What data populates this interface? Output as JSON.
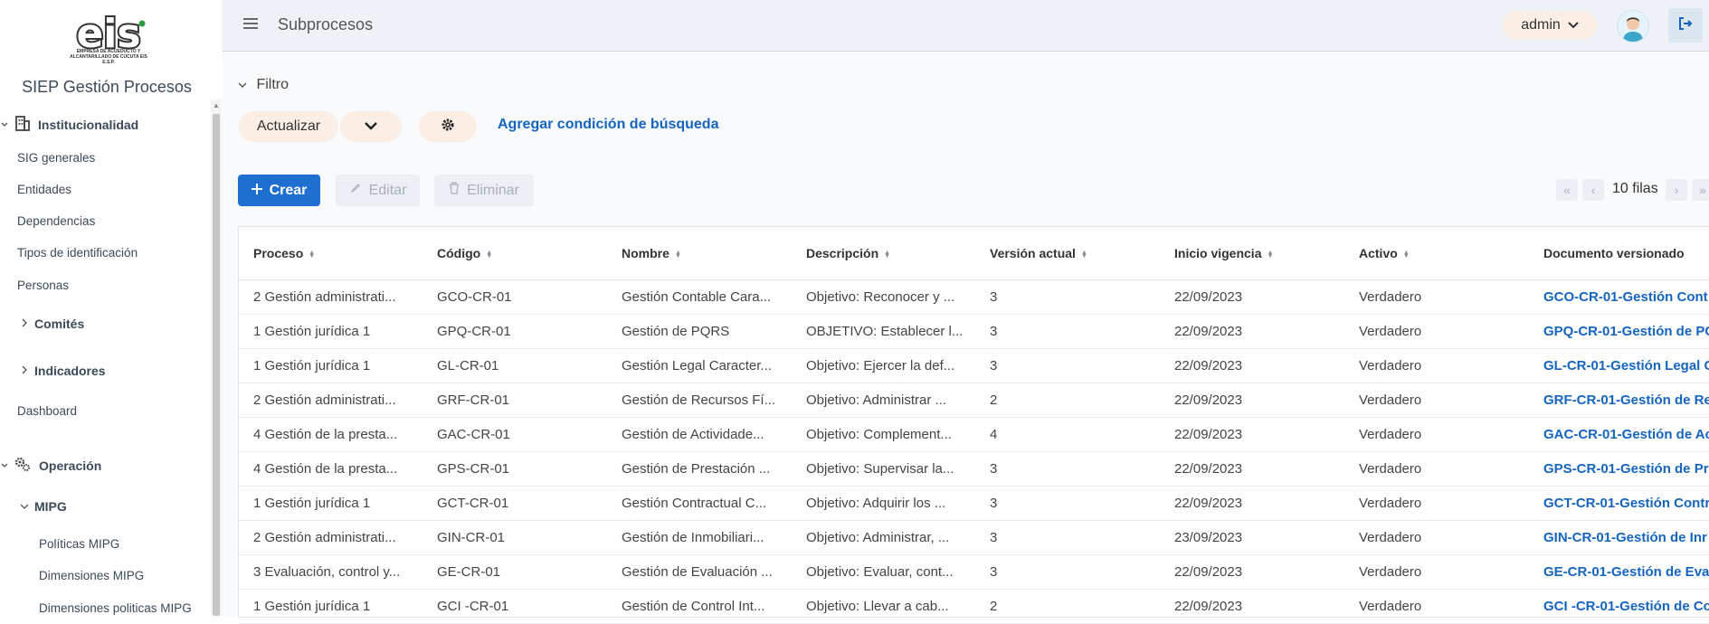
{
  "app": {
    "title": "SIEP Gestión Procesos",
    "logo_text": "eis",
    "logo_caption": "EMPRESA DE ACUEDUCTO Y ALCANTARILLADO DE CÚCUTA EIS E.S.P."
  },
  "sidebar": {
    "group_institucionalidad": "Institucionalidad",
    "items_institucionalidad": [
      "SIG generales",
      "Entidades",
      "Dependencias",
      "Tipos de identificación",
      "Personas"
    ],
    "comites": "Comités",
    "indicadores": "Indicadores",
    "dashboard": "Dashboard",
    "group_operacion": "Operación",
    "mipg": "MIPG",
    "mipg_items": [
      "Políticas MIPG",
      "Dimensiones MIPG",
      "Dimensiones politicas MIPG"
    ]
  },
  "header": {
    "title": "Subprocesos",
    "user": "admin"
  },
  "toolbar": {
    "filter": "Filtro",
    "refresh": "Actualizar",
    "add_condition": "Agregar condición de búsqueda",
    "create": "Crear",
    "edit": "Editar",
    "delete": "Eliminar",
    "rows": "10 filas"
  },
  "colors": {
    "primary": "#1f6fd0",
    "link": "#1565c0",
    "soft_button": "#fbeee4",
    "header_bg": "#eef2f7"
  },
  "table": {
    "columns": [
      "Proceso",
      "Código",
      "Nombre",
      "Descripción",
      "Versión actual",
      "Inicio vigencia",
      "Activo",
      "Documento versionado"
    ],
    "rows": [
      [
        "2 Gestión administrati...",
        "GCO-CR-01",
        "Gestión Contable Cara...",
        "Objetivo: Reconocer y ...",
        "3",
        "22/09/2023",
        "Verdadero",
        "GCO-CR-01-Gestión Cont"
      ],
      [
        "1 Gestión jurídica 1",
        "GPQ-CR-01",
        "Gestión de PQRS",
        "OBJETIVO: Establecer l...",
        "3",
        "22/09/2023",
        "Verdadero",
        "GPQ-CR-01-Gestión de PC"
      ],
      [
        "1 Gestión jurídica 1",
        "GL-CR-01",
        "Gestión Legal Caracter...",
        "Objetivo: Ejercer la def...",
        "3",
        "22/09/2023",
        "Verdadero",
        "GL-CR-01-Gestión Legal C"
      ],
      [
        "2 Gestión administrati...",
        "GRF-CR-01",
        "Gestión de Recursos Fí...",
        "Objetivo: Administrar ...",
        "2",
        "22/09/2023",
        "Verdadero",
        "GRF-CR-01-Gestión de Re"
      ],
      [
        "4 Gestión de la presta...",
        "GAC-CR-01",
        "Gestión de Actividade...",
        "Objetivo: Complement...",
        "4",
        "22/09/2023",
        "Verdadero",
        "GAC-CR-01-Gestión de Ac"
      ],
      [
        "4 Gestión de la presta...",
        "GPS-CR-01",
        "Gestión de Prestación ...",
        "Objetivo: Supervisar la...",
        "3",
        "22/09/2023",
        "Verdadero",
        "GPS-CR-01-Gestión de Pr"
      ],
      [
        "1 Gestión jurídica 1",
        "GCT-CR-01",
        "Gestión Contractual C...",
        "Objetivo: Adquirir los ...",
        "3",
        "22/09/2023",
        "Verdadero",
        "GCT-CR-01-Gestión Contr"
      ],
      [
        "2 Gestión administrati...",
        "GIN-CR-01",
        "Gestión de Inmobiliari...",
        "Objetivo: Administrar, ...",
        "3",
        "23/09/2023",
        "Verdadero",
        "GIN-CR-01-Gestión de Inr"
      ],
      [
        "3 Evaluación, control y...",
        "GE-CR-01",
        "Gestión de Evaluación ...",
        "Objetivo: Evaluar, cont...",
        "3",
        "22/09/2023",
        "Verdadero",
        "GE-CR-01-Gestión de Eval"
      ],
      [
        "1 Gestión jurídica 1",
        "GCI -CR-01",
        "Gestión de Control Int...",
        "Objetivo: Llevar a cab...",
        "2",
        "22/09/2023",
        "Verdadero",
        "GCI -CR-01-Gestión de Co"
      ]
    ]
  }
}
